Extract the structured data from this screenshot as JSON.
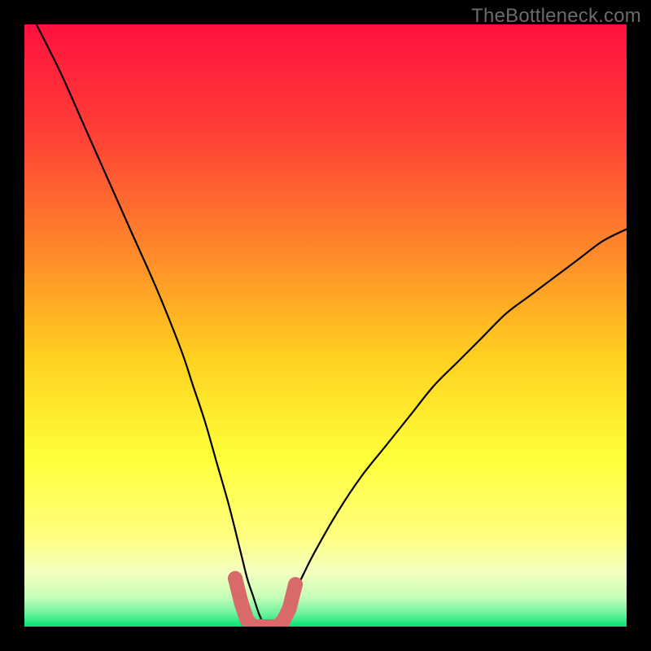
{
  "watermark": "TheBottleneck.com",
  "colors": {
    "frame": "#000000",
    "grad_top": "#ff113f",
    "grad_mid1": "#ff6a2d",
    "grad_mid2": "#ffd21e",
    "grad_mid3": "#ffff55",
    "grad_mid4": "#f2ffb8",
    "grad_bottom": "#00e472",
    "curve": "#000000",
    "marker": "#d86a6a",
    "marker_stroke": "#c95a5a"
  },
  "chart_data": {
    "type": "line",
    "title": "",
    "xlabel": "",
    "ylabel": "",
    "xlim": [
      0,
      100
    ],
    "ylim": [
      0,
      100
    ],
    "series": [
      {
        "name": "bottleneck-curve",
        "x": [
          2,
          6,
          10,
          14,
          18,
          22,
          26,
          28,
          30,
          32,
          34,
          36,
          37,
          38,
          39,
          40,
          41,
          42,
          43,
          44,
          46,
          48,
          52,
          56,
          60,
          64,
          68,
          72,
          76,
          80,
          84,
          88,
          92,
          96,
          100
        ],
        "y": [
          100,
          92,
          83,
          74,
          65,
          56,
          46,
          40,
          34,
          27,
          20,
          12,
          8,
          5,
          2,
          0,
          0,
          0,
          2,
          4,
          8,
          12,
          19,
          25,
          30,
          35,
          40,
          44,
          48,
          52,
          55,
          58,
          61,
          64,
          66
        ]
      },
      {
        "name": "valley-markers",
        "x": [
          35,
          36,
          37,
          38,
          39,
          40,
          41,
          42,
          43,
          44,
          45
        ],
        "y": [
          8,
          4,
          1,
          0,
          0,
          0,
          0,
          0,
          1,
          3,
          7
        ]
      }
    ],
    "annotations": [
      {
        "text": "TheBottleneck.com",
        "pos": "top-right"
      }
    ]
  }
}
